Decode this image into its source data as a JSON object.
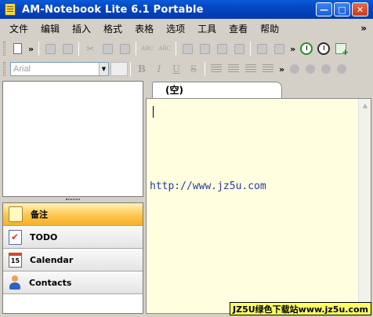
{
  "window": {
    "title": "AM-Notebook Lite  6.1 Portable"
  },
  "menu": [
    "文件",
    "编辑",
    "插入",
    "格式",
    "表格",
    "选项",
    "工具",
    "查看",
    "帮助"
  ],
  "toolbar": {
    "more_label": "»",
    "spell_label": "ABC",
    "font": {
      "value": "Arial"
    },
    "bold": "B",
    "italic": "I",
    "underline": "U",
    "strike": "S"
  },
  "nav": {
    "items": [
      {
        "label": "备注",
        "icon": "note-icon",
        "active": true
      },
      {
        "label": "TODO",
        "icon": "todo-icon",
        "active": false
      },
      {
        "label": "Calendar",
        "icon": "calendar-icon",
        "calendar_day": "15",
        "active": false
      },
      {
        "label": "Contacts",
        "icon": "contacts-icon",
        "active": false
      }
    ]
  },
  "editor": {
    "tab_label": "(空)",
    "content": "http://www.jz5u.com"
  },
  "watermark": "JZ5U绿色下载站www.jz5u.com",
  "colors": {
    "titlebar": "#0a5ad8",
    "active_nav": "#ffc64e",
    "editor_bg": "#ffffe0",
    "link_text": "#2a3a9a"
  }
}
